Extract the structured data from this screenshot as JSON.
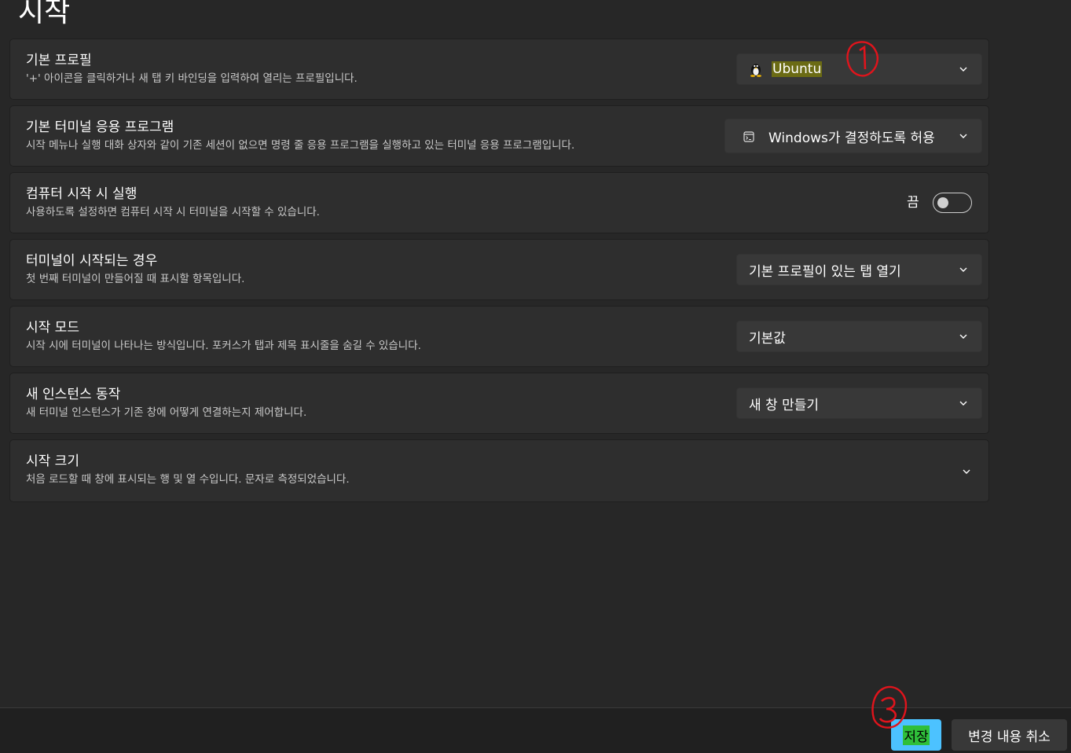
{
  "page_title": "시작",
  "settings": [
    {
      "title": "기본 프로필",
      "desc": "'+' 아이콘을 클릭하거나 새 탭 키 바인딩을 입력하여 열리는 프로필입니다.",
      "value": "Ubuntu",
      "icon": "linux-penguin-icon"
    },
    {
      "title": "기본 터미널 응용 프로그램",
      "desc": "시작 메뉴나 실행 대화 상자와 같이 기존 세션이 없으면 명령 줄 응용 프로그램을 실행하고 있는 터미널 응용 프로그램입니다.",
      "value": "Windows가 결정하도록 허용",
      "icon": "terminal-window-icon"
    },
    {
      "title": "컴퓨터 시작 시 실행",
      "desc": "사용하도록 설정하면 컴퓨터 시작 시 터미널을 시작할 수 있습니다.",
      "toggle_label": "끔",
      "toggle_on": false
    },
    {
      "title": "터미널이 시작되는 경우",
      "desc": "첫 번째 터미널이 만들어질 때 표시할 항목입니다.",
      "value": "기본 프로필이 있는 탭 열기"
    },
    {
      "title": "시작 모드",
      "desc": "시작 시에 터미널이 나타나는 방식입니다. 포커스가 탭과 제목 표시줄을 숨길 수 있습니다.",
      "value": "기본값"
    },
    {
      "title": "새 인스턴스 동작",
      "desc": "새 터미널 인스턴스가 기존 창에 어떻게 연결하는지 제어합니다.",
      "value": "새 창 만들기"
    },
    {
      "title": "시작 크기",
      "desc": "처음 로드할 때 창에 표시되는 행 및 열 수입니다. 문자로 측정되었습니다."
    }
  ],
  "footer": {
    "save_label": "저장",
    "discard_label": "변경 내용 취소"
  },
  "annotations": {
    "mark_1": "1",
    "mark_3": "3",
    "color": "#e0141c"
  },
  "colors": {
    "background": "#272727",
    "card": "#2e2e2e",
    "accent": "#4cc2ff"
  }
}
